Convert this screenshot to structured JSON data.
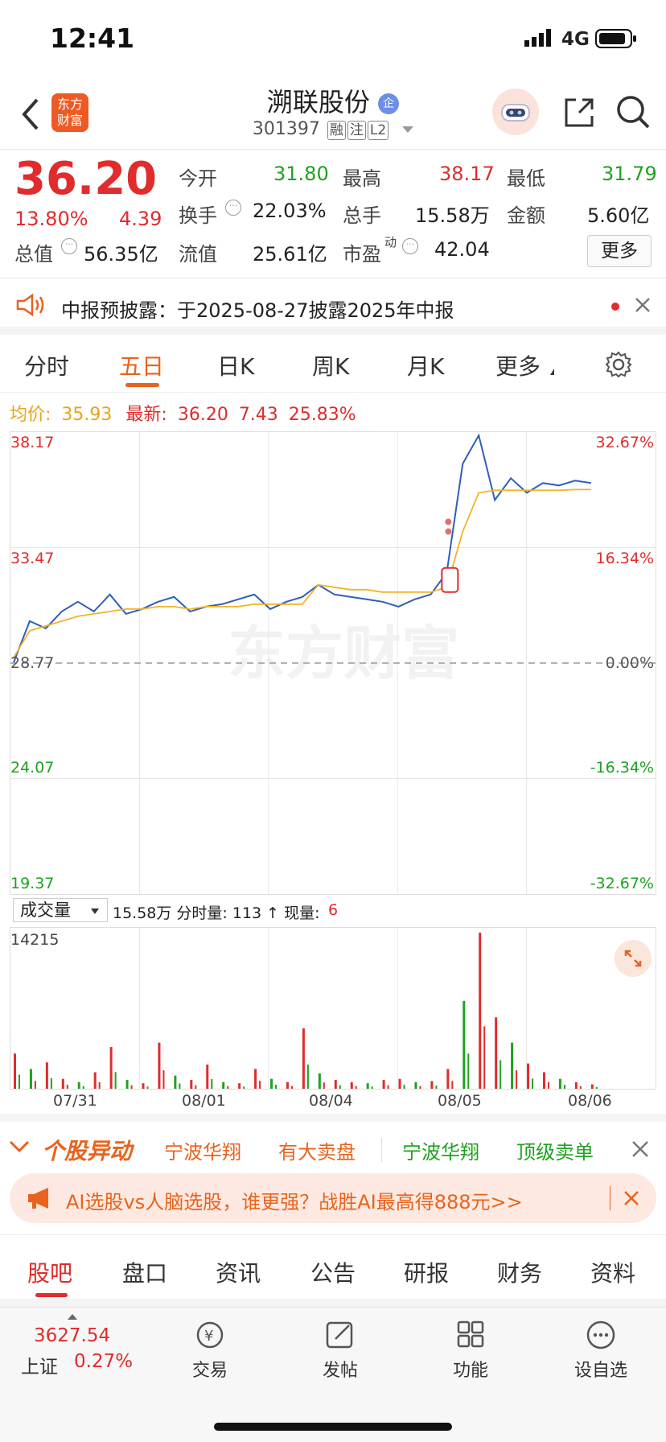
{
  "status_bar": {
    "time": "12:41",
    "network": "4G"
  },
  "header": {
    "logo_text": "东方财富",
    "stock_name": "溯联股份",
    "verified_badge": "企",
    "stock_code": "301397",
    "tags": [
      "融",
      "注",
      "L2"
    ]
  },
  "quote": {
    "price": "36.20",
    "change_pct": "13.80%",
    "change": "4.39",
    "fields": {
      "open_label": "今开",
      "open": "31.80",
      "high_label": "最高",
      "high": "38.17",
      "low_label": "最低",
      "low": "31.79",
      "turnover_label": "换手",
      "turnover": "22.03%",
      "volume_label": "总手",
      "volume": "15.58万",
      "amount_label": "金额",
      "amount": "5.60亿",
      "mktcap_label": "总值",
      "mktcap": "56.35亿",
      "float_label": "流值",
      "float": "25.61亿",
      "pe_label": "市盈",
      "pe_sup": "动",
      "pe": "42.04"
    },
    "more_label": "更多"
  },
  "notice": {
    "text": "中报预披露：于2025-08-27披露2025年中报"
  },
  "chart_tabs": [
    "分时",
    "五日",
    "日K",
    "周K",
    "月K",
    "更多"
  ],
  "active_chart_tab": "五日",
  "price_info": {
    "avg_label": "均价:",
    "avg": "35.93",
    "latest_label": "最新:",
    "latest": "36.20",
    "change": "7.43",
    "change_pct": "25.83%"
  },
  "watermark": "东方财富",
  "volume_bar": {
    "select_label": "成交量",
    "summary": "15.58万 分时量: 113 ↑ 现量:",
    "current": "6"
  },
  "chart_data": [
    {
      "type": "line",
      "title": "",
      "x": [
        "07/31",
        "08/01",
        "08/04",
        "08/05",
        "08/06"
      ],
      "y_ticks_left": [
        "38.17",
        "33.47",
        "28.77",
        "24.07",
        "19.37"
      ],
      "y_ticks_right": [
        "32.67%",
        "16.34%",
        "0.00%",
        "-16.34%",
        "-32.67%"
      ],
      "ylim": [
        19.37,
        38.17
      ],
      "prev_close": 28.77,
      "series": [
        {
          "values": [
            28.8,
            30.5,
            30.2,
            30.9,
            31.3,
            30.9,
            31.6,
            30.8,
            31.0,
            31.3,
            31.5,
            30.9,
            31.1,
            31.2,
            31.4,
            31.6,
            31.0,
            31.3,
            31.5,
            32.0,
            31.6,
            31.5,
            31.4,
            31.3,
            31.1,
            31.4,
            31.6,
            32.5,
            37.0,
            38.17,
            35.5,
            36.4,
            35.8,
            36.2,
            36.1,
            36.3,
            36.2
          ]
        },
        {
          "values": [
            29.0,
            30.1,
            30.3,
            30.5,
            30.7,
            30.8,
            30.9,
            31.0,
            31.0,
            31.1,
            31.1,
            31.0,
            31.1,
            31.1,
            31.1,
            31.2,
            31.2,
            31.2,
            31.2,
            32.0,
            31.9,
            31.8,
            31.8,
            31.7,
            31.7,
            31.7,
            31.7,
            31.9,
            34.2,
            35.8,
            35.9,
            35.9,
            35.9,
            35.9,
            35.9,
            35.93,
            35.93
          ]
        }
      ]
    },
    {
      "type": "bar",
      "title": "",
      "x": [
        "07/31",
        "08/01",
        "08/04",
        "08/05",
        "08/06"
      ],
      "ylim": [
        0,
        14215
      ],
      "y_ticks": [
        "14215"
      ],
      "values": [
        3200,
        1800,
        2400,
        900,
        600,
        1500,
        3800,
        800,
        500,
        4200,
        1200,
        800,
        2200,
        600,
        500,
        1800,
        900,
        600,
        5500,
        1400,
        800,
        600,
        500,
        800,
        900,
        600,
        700,
        1800,
        8000,
        14215,
        6500,
        4200,
        2300,
        1500,
        900,
        600,
        400
      ]
    }
  ],
  "anomaly": {
    "title": "个股异动",
    "items": [
      {
        "text": "宁波华翔",
        "color": "#e8631d"
      },
      {
        "text": "有大卖盘",
        "color": "#e8631d"
      },
      {
        "text": "宁波华翔",
        "color": "#1fa21f"
      },
      {
        "text": "顶级卖单",
        "color": "#1fa21f"
      }
    ]
  },
  "ai_banner": {
    "text": "AI选股vs人脑选股，谁更强？战胜AI最高得888元>>"
  },
  "section_tabs": [
    "股吧",
    "盘口",
    "资讯",
    "公告",
    "研报",
    "财务",
    "资料"
  ],
  "bottom_nav": {
    "index_value": "3627.54",
    "index_name": "上证",
    "index_change": "0.27%",
    "items": [
      "交易",
      "发帖",
      "功能",
      "设自选"
    ]
  }
}
